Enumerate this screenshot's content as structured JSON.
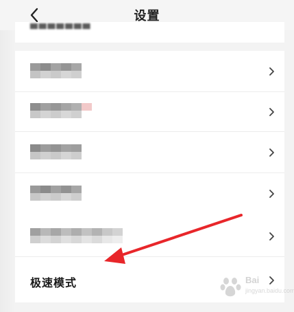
{
  "header": {
    "title": "设置",
    "back_icon": "chevron-left-icon"
  },
  "settings": {
    "items": [
      {
        "id": "item-1",
        "label_obscured": true
      },
      {
        "id": "item-2",
        "label_obscured": true
      },
      {
        "id": "item-3",
        "label_obscured": true
      },
      {
        "id": "item-4",
        "label_obscured": true
      },
      {
        "id": "item-5",
        "label_obscured": true
      },
      {
        "id": "speed-mode",
        "label": "极速模式"
      }
    ],
    "chevron_icon": "chevron-right-icon"
  },
  "annotation": {
    "arrow_color": "#e8262a"
  },
  "watermark": {
    "brand": "Bai",
    "sub": "jingyan.baidu.com"
  },
  "colors": {
    "background": "#f3f3f3",
    "card": "#ffffff",
    "separator": "#ececec"
  }
}
